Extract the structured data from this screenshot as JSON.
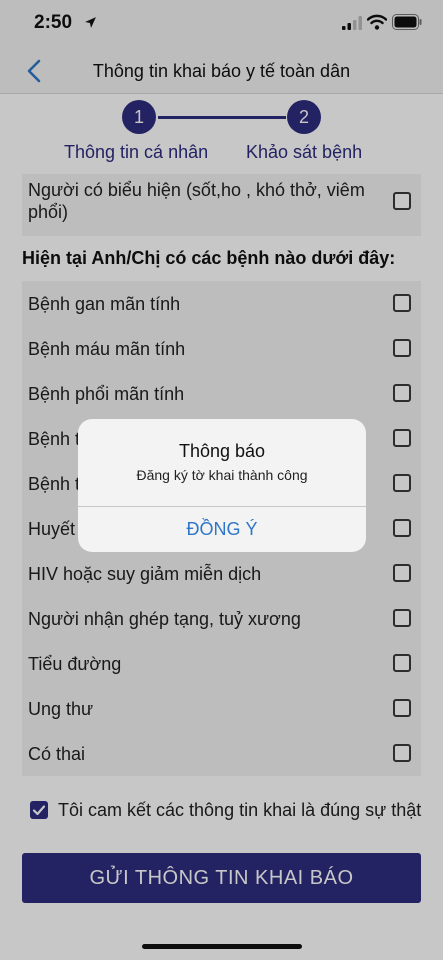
{
  "status_bar": {
    "time": "2:50"
  },
  "nav": {
    "title": "Thông tin khai báo y tế toàn dân"
  },
  "stepper": {
    "steps": [
      {
        "number": "1",
        "label": "Thông tin cá nhân"
      },
      {
        "number": "2",
        "label": "Khảo sát bệnh"
      }
    ]
  },
  "symptoms": {
    "row": {
      "label": "Người có biểu hiện (sốt,ho , khó thở, viêm phổi)",
      "checked": false
    }
  },
  "diseases": {
    "section_title": "Hiện tại Anh/Chị có các bệnh nào dưới đây:",
    "items": [
      {
        "label": "Bệnh gan mãn tính",
        "checked": false
      },
      {
        "label": "Bệnh máu mãn tính",
        "checked": false
      },
      {
        "label": "Bệnh phổi mãn tính",
        "checked": false
      },
      {
        "label": "Bệnh t",
        "checked": false
      },
      {
        "label": "Bệnh t",
        "checked": false
      },
      {
        "label": "Huyết",
        "checked": false
      },
      {
        "label": "HIV hoặc suy giảm miễn dịch",
        "checked": false
      },
      {
        "label": "Người nhận ghép tạng, tuỷ xương",
        "checked": false
      },
      {
        "label": "Tiểu đường",
        "checked": false
      },
      {
        "label": "Ung thư",
        "checked": false
      },
      {
        "label": "Có thai",
        "checked": false
      }
    ]
  },
  "commitment": {
    "label": "Tôi cam kết các thông tin khai là đúng sự thật",
    "checked": true
  },
  "submit": {
    "label": "GỬI THÔNG TIN KHAI BÁO"
  },
  "alert": {
    "title": "Thông báo",
    "message": "Đăng ký tờ khai thành công",
    "button": "ĐỒNG Ý"
  },
  "colors": {
    "primary": "#2e2c7f",
    "alert_button": "#2f76c8",
    "row_background": "#f2f2f2"
  }
}
